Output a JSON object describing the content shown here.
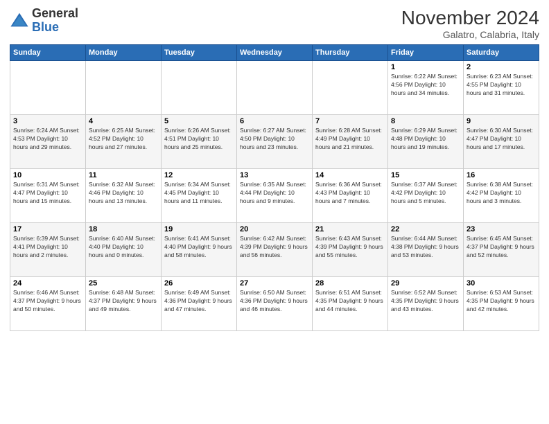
{
  "header": {
    "logo_general": "General",
    "logo_blue": "Blue",
    "title": "November 2024",
    "location": "Galatro, Calabria, Italy"
  },
  "weekdays": [
    "Sunday",
    "Monday",
    "Tuesday",
    "Wednesday",
    "Thursday",
    "Friday",
    "Saturday"
  ],
  "weeks": [
    [
      {
        "day": "",
        "info": ""
      },
      {
        "day": "",
        "info": ""
      },
      {
        "day": "",
        "info": ""
      },
      {
        "day": "",
        "info": ""
      },
      {
        "day": "",
        "info": ""
      },
      {
        "day": "1",
        "info": "Sunrise: 6:22 AM\nSunset: 4:56 PM\nDaylight: 10 hours\nand 34 minutes."
      },
      {
        "day": "2",
        "info": "Sunrise: 6:23 AM\nSunset: 4:55 PM\nDaylight: 10 hours\nand 31 minutes."
      }
    ],
    [
      {
        "day": "3",
        "info": "Sunrise: 6:24 AM\nSunset: 4:53 PM\nDaylight: 10 hours\nand 29 minutes."
      },
      {
        "day": "4",
        "info": "Sunrise: 6:25 AM\nSunset: 4:52 PM\nDaylight: 10 hours\nand 27 minutes."
      },
      {
        "day": "5",
        "info": "Sunrise: 6:26 AM\nSunset: 4:51 PM\nDaylight: 10 hours\nand 25 minutes."
      },
      {
        "day": "6",
        "info": "Sunrise: 6:27 AM\nSunset: 4:50 PM\nDaylight: 10 hours\nand 23 minutes."
      },
      {
        "day": "7",
        "info": "Sunrise: 6:28 AM\nSunset: 4:49 PM\nDaylight: 10 hours\nand 21 minutes."
      },
      {
        "day": "8",
        "info": "Sunrise: 6:29 AM\nSunset: 4:48 PM\nDaylight: 10 hours\nand 19 minutes."
      },
      {
        "day": "9",
        "info": "Sunrise: 6:30 AM\nSunset: 4:47 PM\nDaylight: 10 hours\nand 17 minutes."
      }
    ],
    [
      {
        "day": "10",
        "info": "Sunrise: 6:31 AM\nSunset: 4:47 PM\nDaylight: 10 hours\nand 15 minutes."
      },
      {
        "day": "11",
        "info": "Sunrise: 6:32 AM\nSunset: 4:46 PM\nDaylight: 10 hours\nand 13 minutes."
      },
      {
        "day": "12",
        "info": "Sunrise: 6:34 AM\nSunset: 4:45 PM\nDaylight: 10 hours\nand 11 minutes."
      },
      {
        "day": "13",
        "info": "Sunrise: 6:35 AM\nSunset: 4:44 PM\nDaylight: 10 hours\nand 9 minutes."
      },
      {
        "day": "14",
        "info": "Sunrise: 6:36 AM\nSunset: 4:43 PM\nDaylight: 10 hours\nand 7 minutes."
      },
      {
        "day": "15",
        "info": "Sunrise: 6:37 AM\nSunset: 4:42 PM\nDaylight: 10 hours\nand 5 minutes."
      },
      {
        "day": "16",
        "info": "Sunrise: 6:38 AM\nSunset: 4:42 PM\nDaylight: 10 hours\nand 3 minutes."
      }
    ],
    [
      {
        "day": "17",
        "info": "Sunrise: 6:39 AM\nSunset: 4:41 PM\nDaylight: 10 hours\nand 2 minutes."
      },
      {
        "day": "18",
        "info": "Sunrise: 6:40 AM\nSunset: 4:40 PM\nDaylight: 10 hours\nand 0 minutes."
      },
      {
        "day": "19",
        "info": "Sunrise: 6:41 AM\nSunset: 4:40 PM\nDaylight: 9 hours\nand 58 minutes."
      },
      {
        "day": "20",
        "info": "Sunrise: 6:42 AM\nSunset: 4:39 PM\nDaylight: 9 hours\nand 56 minutes."
      },
      {
        "day": "21",
        "info": "Sunrise: 6:43 AM\nSunset: 4:39 PM\nDaylight: 9 hours\nand 55 minutes."
      },
      {
        "day": "22",
        "info": "Sunrise: 6:44 AM\nSunset: 4:38 PM\nDaylight: 9 hours\nand 53 minutes."
      },
      {
        "day": "23",
        "info": "Sunrise: 6:45 AM\nSunset: 4:37 PM\nDaylight: 9 hours\nand 52 minutes."
      }
    ],
    [
      {
        "day": "24",
        "info": "Sunrise: 6:46 AM\nSunset: 4:37 PM\nDaylight: 9 hours\nand 50 minutes."
      },
      {
        "day": "25",
        "info": "Sunrise: 6:48 AM\nSunset: 4:37 PM\nDaylight: 9 hours\nand 49 minutes."
      },
      {
        "day": "26",
        "info": "Sunrise: 6:49 AM\nSunset: 4:36 PM\nDaylight: 9 hours\nand 47 minutes."
      },
      {
        "day": "27",
        "info": "Sunrise: 6:50 AM\nSunset: 4:36 PM\nDaylight: 9 hours\nand 46 minutes."
      },
      {
        "day": "28",
        "info": "Sunrise: 6:51 AM\nSunset: 4:35 PM\nDaylight: 9 hours\nand 44 minutes."
      },
      {
        "day": "29",
        "info": "Sunrise: 6:52 AM\nSunset: 4:35 PM\nDaylight: 9 hours\nand 43 minutes."
      },
      {
        "day": "30",
        "info": "Sunrise: 6:53 AM\nSunset: 4:35 PM\nDaylight: 9 hours\nand 42 minutes."
      }
    ]
  ]
}
